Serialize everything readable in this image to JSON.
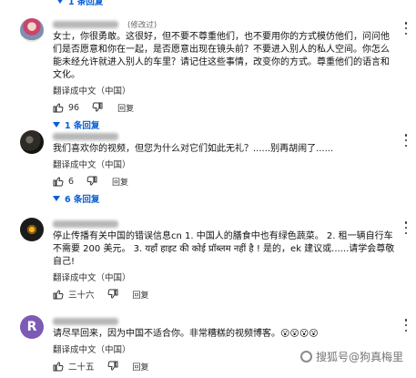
{
  "top_replies": {
    "label": "1 条回复",
    "icon": "chevron-down-icon"
  },
  "comments": [
    {
      "edited": "(修改过)",
      "text": "女士，你很勇敢。这很好，但不要不尊重他们，也不要用你的方式模仿他们，问问他们是否愿意和你在一起，是否愿意出现在镜头前？不要进入别人的私人空间。你怎么能未经允许就进入别人的车里？请记住这些事情，改变你的方式。尊重他们的语言和文化。",
      "translate": "翻译成中文（中国）",
      "likes": "96",
      "reply": "回复",
      "replies": "1 条回复"
    },
    {
      "text": "我们喜欢你的视频，但您为什么对它们如此无礼？......别再胡闹了......",
      "translate": "翻译成中文（中国）",
      "likes": "6",
      "reply": "回复",
      "replies": "6 条回复"
    },
    {
      "text": "停止传播有关中国的错误信息cn 1. 中国人的膳食中也有绿色蔬菜。 2. 租一辆自行车不需要 200 美元。 3. यहाँ हाइट की कोई प्रॉब्लम नहीं है ! 是的，ek 建议或......请学会尊敬自己!",
      "translate": "翻译成中文（中国）",
      "likes": "三十六",
      "reply": "回复"
    },
    {
      "avatar_letter": "R",
      "text": "请尽早回来，因为中国不适合你。非常糟糕的视频博客。😮😮😮😮",
      "translate": "翻译成中文（中国）",
      "likes": "二十五",
      "reply": "回复"
    }
  ],
  "watermark": "搜狐号@狗真梅里",
  "colors": {
    "link": "#065fd4",
    "avatar_r": "#7b5bb5",
    "text": "#111111",
    "background": "#ffffff"
  }
}
